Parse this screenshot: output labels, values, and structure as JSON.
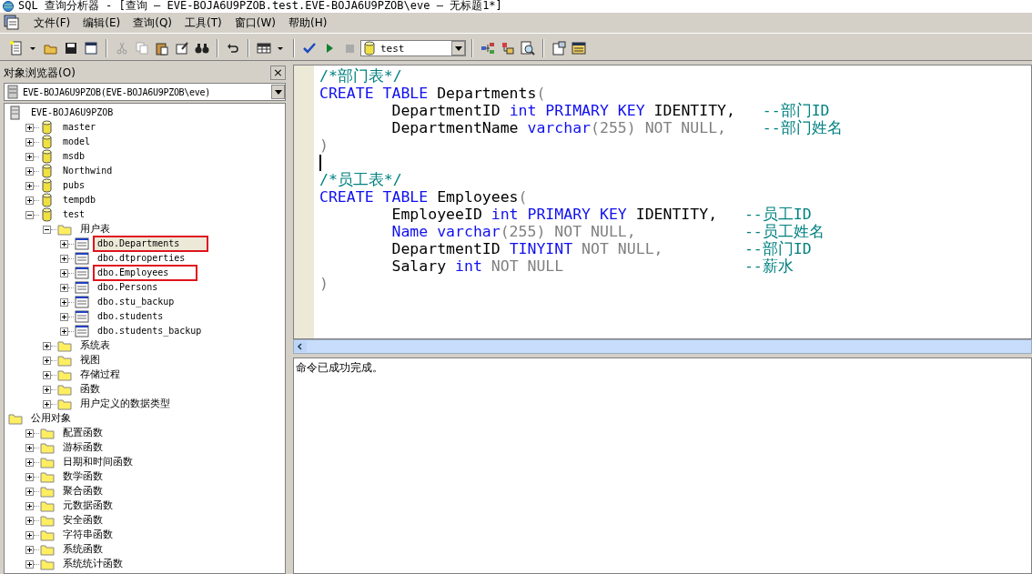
{
  "window": {
    "title": "SQL 查询分析器 - [查询 — EVE-BOJA6U9PZOB.test.EVE-BOJA6U9PZOB\\eve — 无标题1*]"
  },
  "menu": [
    "文件(F)",
    "编辑(E)",
    "查询(Q)",
    "工具(T)",
    "窗口(W)",
    "帮助(H)"
  ],
  "toolbar": {
    "database": "test"
  },
  "object_browser": {
    "title": "对象浏览器(O)",
    "close": "×",
    "server_select": "EVE-BOJA6U9PZOB(EVE-BOJA6U9PZOB\\eve)",
    "tree": [
      {
        "label": "EVE-BOJA6U9PZOB",
        "kind": "server",
        "expanded": true,
        "children": [
          {
            "label": "master",
            "kind": "database",
            "expanded": false
          },
          {
            "label": "model",
            "kind": "database",
            "expanded": false
          },
          {
            "label": "msdb",
            "kind": "database",
            "expanded": false
          },
          {
            "label": "Northwind",
            "kind": "database",
            "expanded": false
          },
          {
            "label": "pubs",
            "kind": "database",
            "expanded": false
          },
          {
            "label": "tempdb",
            "kind": "database",
            "expanded": false
          },
          {
            "label": "test",
            "kind": "database",
            "expanded": true,
            "children": [
              {
                "label": "用户表",
                "kind": "folder",
                "expanded": true,
                "children": [
                  {
                    "label": "dbo.Departments",
                    "kind": "table",
                    "expanded": false,
                    "selected": true,
                    "marked": true
                  },
                  {
                    "label": "dbo.dtproperties",
                    "kind": "table",
                    "expanded": false,
                    "selected": false,
                    "marked": false
                  },
                  {
                    "label": "dbo.Employees",
                    "kind": "table",
                    "expanded": false,
                    "selected": false,
                    "marked": true
                  },
                  {
                    "label": "dbo.Persons",
                    "kind": "table",
                    "expanded": false,
                    "selected": false,
                    "marked": false
                  },
                  {
                    "label": "dbo.stu_backup",
                    "kind": "table",
                    "expanded": false,
                    "selected": false,
                    "marked": false
                  },
                  {
                    "label": "dbo.students",
                    "kind": "table",
                    "expanded": false,
                    "selected": false,
                    "marked": false
                  },
                  {
                    "label": "dbo.students_backup",
                    "kind": "table",
                    "expanded": false,
                    "selected": false,
                    "marked": false
                  }
                ]
              },
              {
                "label": "系统表",
                "kind": "folder",
                "expanded": false
              },
              {
                "label": "视图",
                "kind": "folder",
                "expanded": false
              },
              {
                "label": "存储过程",
                "kind": "folder",
                "expanded": false
              },
              {
                "label": "函数",
                "kind": "folder",
                "expanded": false
              },
              {
                "label": "用户定义的数据类型",
                "kind": "folder",
                "expanded": false
              }
            ]
          }
        ]
      },
      {
        "label": "公用对象",
        "kind": "folder",
        "expanded": true,
        "children": [
          {
            "label": "配置函数",
            "kind": "folder",
            "expanded": false
          },
          {
            "label": "游标函数",
            "kind": "folder",
            "expanded": false
          },
          {
            "label": "日期和时间函数",
            "kind": "folder",
            "expanded": false
          },
          {
            "label": "数学函数",
            "kind": "folder",
            "expanded": false
          },
          {
            "label": "聚合函数",
            "kind": "folder",
            "expanded": false
          },
          {
            "label": "元数据函数",
            "kind": "folder",
            "expanded": false
          },
          {
            "label": "安全函数",
            "kind": "folder",
            "expanded": false
          },
          {
            "label": "字符串函数",
            "kind": "folder",
            "expanded": false
          },
          {
            "label": "系统函数",
            "kind": "folder",
            "expanded": false
          },
          {
            "label": "系统统计函数",
            "kind": "folder",
            "expanded": false
          }
        ]
      }
    ]
  },
  "editor": {
    "lines": [
      [
        {
          "kind": "comment",
          "text": "/*部门表*/"
        }
      ],
      [
        {
          "kind": "keyword",
          "text": "CREATE TABLE"
        },
        {
          "kind": "plain",
          "text": " Departments"
        },
        {
          "kind": "gray",
          "text": "("
        }
      ],
      [
        {
          "kind": "plain",
          "text": "        DepartmentID "
        },
        {
          "kind": "keyword",
          "text": "int PRIMARY KEY"
        },
        {
          "kind": "plain",
          "text": " IDENTITY,   "
        },
        {
          "kind": "comment",
          "text": "--部门ID"
        }
      ],
      [
        {
          "kind": "plain",
          "text": "        DepartmentName "
        },
        {
          "kind": "keyword",
          "text": "varchar"
        },
        {
          "kind": "gray",
          "text": "(255) NOT NULL,    "
        },
        {
          "kind": "comment",
          "text": "--部门姓名"
        }
      ],
      [
        {
          "kind": "gray",
          "text": ")"
        }
      ],
      [
        {
          "kind": "cursor"
        }
      ],
      [
        {
          "kind": "comment",
          "text": "/*员工表*/"
        }
      ],
      [
        {
          "kind": "keyword",
          "text": "CREATE TABLE"
        },
        {
          "kind": "plain",
          "text": " Employees"
        },
        {
          "kind": "gray",
          "text": "("
        }
      ],
      [
        {
          "kind": "plain",
          "text": "        EmployeeID "
        },
        {
          "kind": "keyword",
          "text": "int PRIMARY KEY"
        },
        {
          "kind": "plain",
          "text": " IDENTITY,   "
        },
        {
          "kind": "comment",
          "text": "--员工ID"
        }
      ],
      [
        {
          "kind": "keyword",
          "text": "        Name varchar"
        },
        {
          "kind": "gray",
          "text": "(255) NOT NULL,            "
        },
        {
          "kind": "comment",
          "text": "--员工姓名"
        }
      ],
      [
        {
          "kind": "plain",
          "text": "        DepartmentID "
        },
        {
          "kind": "keyword",
          "text": "TINYINT"
        },
        {
          "kind": "gray",
          "text": " NOT NULL,         "
        },
        {
          "kind": "comment",
          "text": "--部门ID"
        }
      ],
      [
        {
          "kind": "plain",
          "text": "        Salary "
        },
        {
          "kind": "keyword",
          "text": "int"
        },
        {
          "kind": "gray",
          "text": " NOT NULL                    "
        },
        {
          "kind": "comment",
          "text": "--薪水"
        }
      ],
      [
        {
          "kind": "gray",
          "text": ")"
        }
      ]
    ]
  },
  "messages": "命令已成功完成。"
}
